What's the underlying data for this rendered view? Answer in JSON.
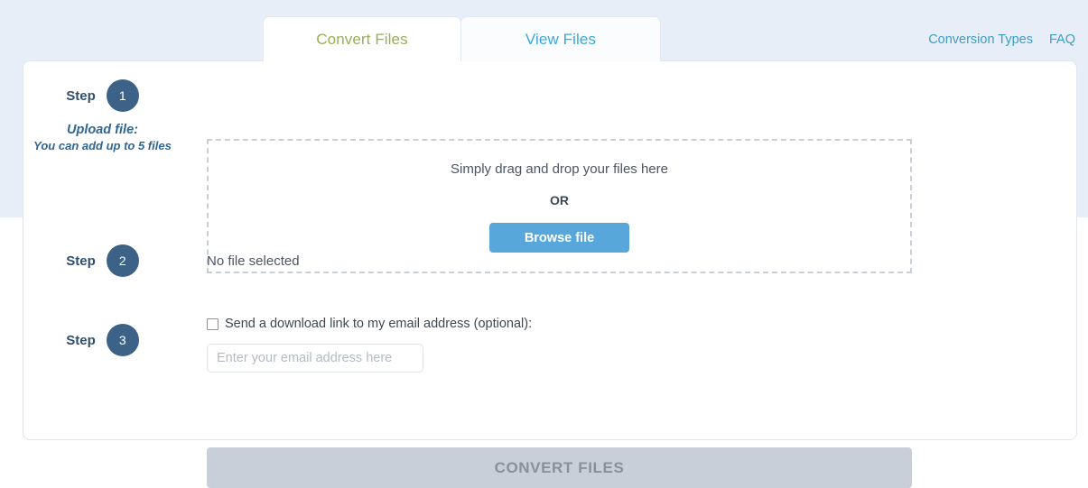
{
  "background": {
    "band_color": "#e8eef7",
    "card_color": "#ffffff"
  },
  "tabs": [
    {
      "label": "Convert Files",
      "active": true,
      "color": "#9aae5a"
    },
    {
      "label": "View Files",
      "active": false,
      "color": "#3ba8dd"
    }
  ],
  "topnav": {
    "links": [
      {
        "label": "Conversion Types"
      },
      {
        "label": "FAQ"
      }
    ],
    "color": "#3a9ec9"
  },
  "steps": [
    {
      "word": "Step",
      "number": "1",
      "sub_title": "Upload file:",
      "sub_text": "You can add up to 5 files"
    },
    {
      "word": "Step",
      "number": "2"
    },
    {
      "word": "Step",
      "number": "3"
    }
  ],
  "dropzone": {
    "instruction": "Simply drag and drop your files here",
    "or_label": "OR",
    "browse_label": "Browse file",
    "browse_color": "#58a7db"
  },
  "file_status": {
    "text": "No file selected"
  },
  "email": {
    "checkbox_label": "Send a download link to my email address (optional):",
    "checked": false,
    "value": "",
    "placeholder": "Enter your email address here"
  },
  "convert": {
    "label": "CONVERT FILES",
    "disabled": true,
    "color": "#c8cfd8"
  },
  "accent": {
    "step_circle": "#3d6287",
    "step_sub_text": "#2f6696"
  }
}
